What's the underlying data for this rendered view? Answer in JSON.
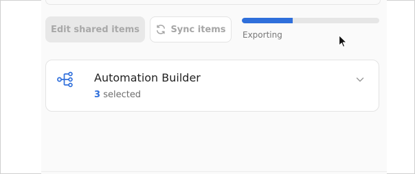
{
  "toolbar": {
    "edit_label": "Edit shared items",
    "sync_label": "Sync items"
  },
  "export": {
    "status_label": "Exporting",
    "progress_fraction": 0.37
  },
  "card": {
    "title": "Automation Builder",
    "selected_count": "3",
    "selected_suffix": "selected"
  },
  "colors": {
    "accent": "#2f6fdb",
    "disabled_bg": "#e8e8e8",
    "disabled_text": "#a8a8a8"
  },
  "icons": {
    "sync": "sync-icon",
    "automation": "workflow-icon",
    "expand": "chevron-down-icon",
    "pointer": "mouse-cursor-icon"
  }
}
